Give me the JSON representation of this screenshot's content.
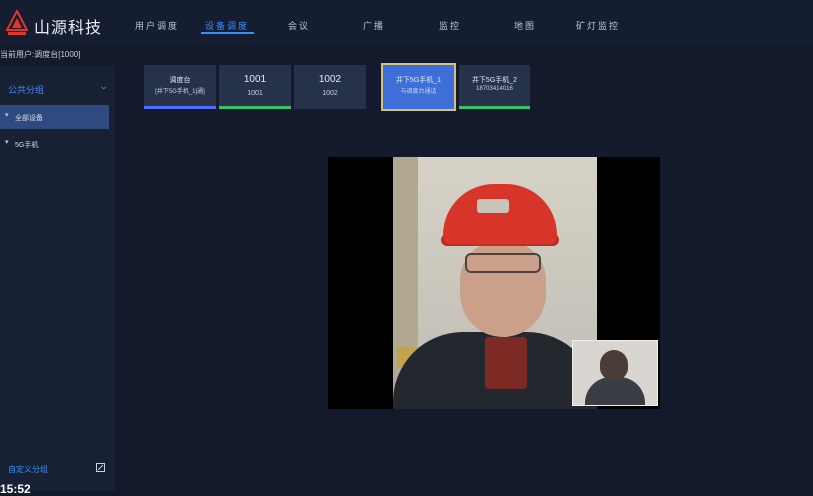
{
  "app": {
    "title": "山源科技"
  },
  "nav": [
    {
      "label": "用户调度",
      "active": false
    },
    {
      "label": "设备调度",
      "active": true
    },
    {
      "label": "会议",
      "active": false
    },
    {
      "label": "广播",
      "active": false
    },
    {
      "label": "监控",
      "active": false
    },
    {
      "label": "地图",
      "active": false
    },
    {
      "label": "矿灯监控",
      "active": false
    }
  ],
  "current_user": "当前用户:调度台[1000]",
  "sidebar": {
    "group_header": "公共分组",
    "items": [
      {
        "label": "全部设备",
        "selected": true
      },
      {
        "label": "5G手机",
        "selected": false
      }
    ],
    "custom_group": "自定义分组"
  },
  "tiles": [
    {
      "line1": "调度台",
      "line2": "[井下5G手机_1]通]",
      "bar_color": "#4f6cff"
    },
    {
      "line1": "1001",
      "line2": "1001",
      "bar_color": "#39c26a"
    },
    {
      "line1": "1002",
      "line2": "1002",
      "bar_color": "#26324a"
    },
    {
      "line1": "井下5G手机_1",
      "line2": "与调度台通话",
      "bar_color": "#3d6fd9"
    },
    {
      "line1": "井下5G手机_2",
      "line2": "18703414016",
      "bar_color": "#39c26a"
    }
  ],
  "clock": "15:52",
  "colors": {
    "accent": "#3b8cff",
    "background": "#121a2b",
    "online": "#39c26a",
    "calling_border": "#d7c07b"
  },
  "icons": {
    "logo": "triangle-logo-icon",
    "expand": "chevron-down-icon",
    "tree": "caret-down-icon",
    "edit": "edit-icon"
  }
}
